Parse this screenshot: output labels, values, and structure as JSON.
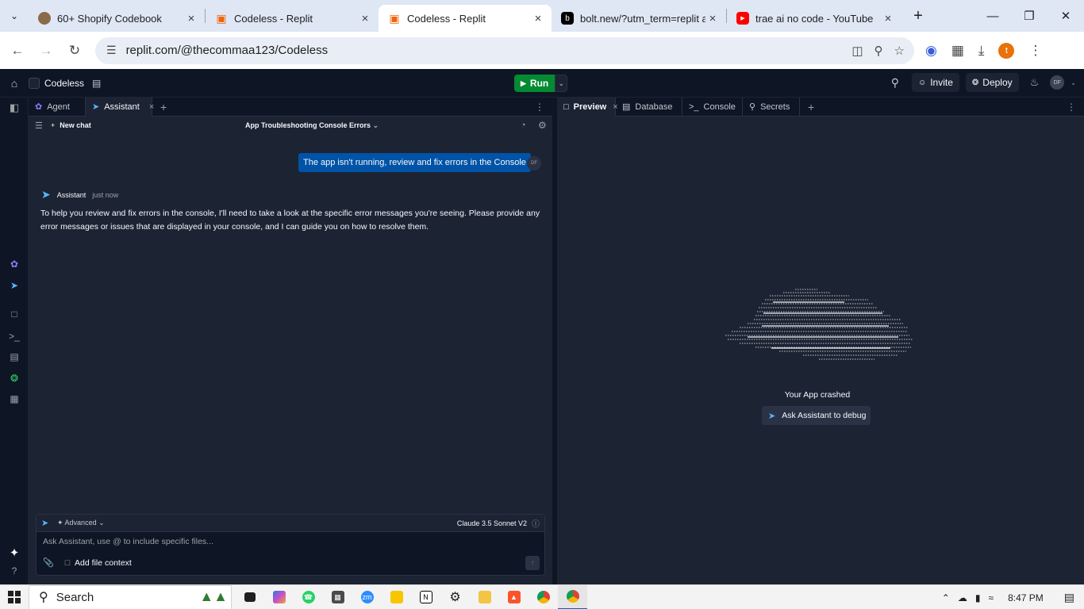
{
  "browser": {
    "tabs": [
      {
        "title": "60+ Shopify Codebook",
        "favicon": "person-photo-icon",
        "color": "#8a6a4a"
      },
      {
        "title": "Codeless - Replit",
        "favicon": "replit-icon",
        "color": "#f26207"
      },
      {
        "title": "Codeless - Replit",
        "favicon": "replit-icon",
        "color": "#f26207"
      },
      {
        "title": "bolt.new/?utm_term=replit a",
        "favicon": "bolt-icon",
        "color": "#000000"
      },
      {
        "title": "trae ai no code - YouTube",
        "favicon": "youtube-icon",
        "color": "#ff0000"
      }
    ],
    "active_tab": 2,
    "url": "replit.com/@thecommaa123/Codeless",
    "profile_initial": "t"
  },
  "replit": {
    "project_name": "Codeless",
    "run_label": "Run",
    "invite_label": "Invite",
    "deploy_label": "Deploy",
    "user_initials": "DF",
    "accent": "#0079f2",
    "run_color": "#038a33"
  },
  "left_pane": {
    "tabs": [
      {
        "label": "Agent"
      },
      {
        "label": "Assistant"
      }
    ],
    "active_tab": 1,
    "new_chat_label": "New chat",
    "chat_title": "App Troubleshooting Console Errors",
    "user_message": "The app isn't running, review and fix errors in the Console",
    "user_initials": "DF",
    "assistant_name": "Assistant",
    "assistant_time": "just now",
    "assistant_message": "To help you review and fix errors in the console, I'll need to take a look at the specific error messages you're seeing. Please provide any error messages or issues that are displayed in your console, and I can guide you on how to resolve them.",
    "composer": {
      "mode_label": "Advanced",
      "model_label": "Claude 3.5 Sonnet V2",
      "placeholder": "Ask Assistant, use @ to include specific files...",
      "add_context_label": "Add file context"
    }
  },
  "right_pane": {
    "tabs": [
      {
        "label": "Preview"
      },
      {
        "label": "Database"
      },
      {
        "label": "Console"
      },
      {
        "label": "Secrets"
      }
    ],
    "active_tab": 0,
    "crash_message": "Your App crashed",
    "debug_button": "Ask Assistant to debug"
  },
  "taskbar": {
    "search_label": "Search",
    "clock": "8:47 PM"
  }
}
